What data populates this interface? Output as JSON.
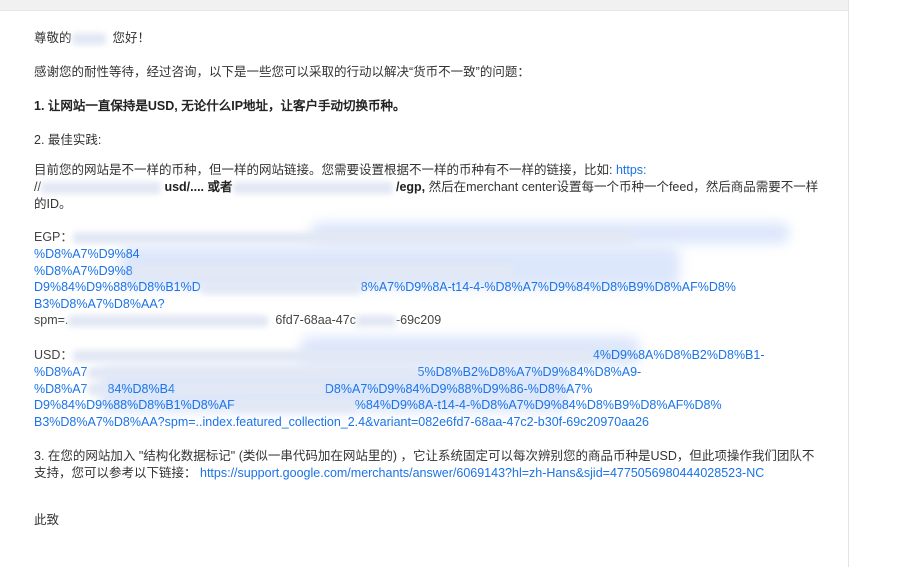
{
  "greeting": {
    "prefix": "尊敬的",
    "suffix": "您好！"
  },
  "intro": "感谢您的耐性等待，经过咨询，以下是一些您可以采取的行动以解决“货币不一致”的问题：",
  "item1": "1. 让网站一直保持是USD, 无论什么IP地址，让客户手动切换币种。",
  "item2_title": "2. 最佳实践:",
  "item2_para_a": "目前您的网站是不一样的币种，但一样的网站链接。您需要设置根据不一样的币种有不一样的链接，比如: ",
  "item2_link_https": "https:",
  "item2_slashes": "//",
  "item2_usd_path": "usd/.... 或者",
  "item2_egp_path": "/egp,",
  "item2_para_b": " 然后在merchant center设置每一个币种一个feed，然后商品需要不一样的ID。",
  "egp": {
    "label": "EGP：",
    "lines": [
      "%D8%A7%D9%84",
      "%D8%A7%D9%8",
      "D9%84%D9%88%D8%B1%D",
      "B3%D8%A7%D8%AA?"
    ],
    "line3_tail": "8%A7%D9%8A-t14-4-%D8%A7%D9%84%D8%B9%D8%AF%D8%",
    "spm_prefix": "spm=.",
    "spm_tail": "6fd7-68aa-47c",
    "spm_end": "-69c209"
  },
  "usd": {
    "label": "USD：",
    "line1_tail": "4%D9%8A%D8%B2%D8%B1-",
    "line2_head": "%D8%A7",
    "line2_tail": "5%D8%B2%D8%A7%D9%84%D8%A9-",
    "line3_head": "%D8%A7",
    "line3_mid": "84%D8%B4",
    "line3_tail": "D8%A7%D9%84%D9%88%D9%86-%D8%A7%",
    "line4_head": "D9%84%D9%88%D8%B1%D8%AF",
    "line4_tail": "%84%D9%8A-t14-4-%D8%A7%D9%84%D8%B9%D8%AF%D8%",
    "line5": "B3%D8%A7%D8%AA?spm=..index.featured_collection_2.4&variant=082e6fd7-68aa-47c2-b30f-69c20970aa26"
  },
  "item3": {
    "text": "3. 在您的网站加入 \"结构化数据标记\" (类似一串代码加在网站里的) ，它让系统固定可以每次辨别您的商品币种是USD，但此项操作我们团队不支持，您可以参考以下链接：",
    "link": "https://support.google.com/merchants/answer/6069143?hl=zh-Hans&sjid=4775056980444028523-NC"
  },
  "closing": "此致",
  "colors": {
    "link": "#1a73e8",
    "text": "#333333",
    "redaction": "#dde7fb"
  }
}
